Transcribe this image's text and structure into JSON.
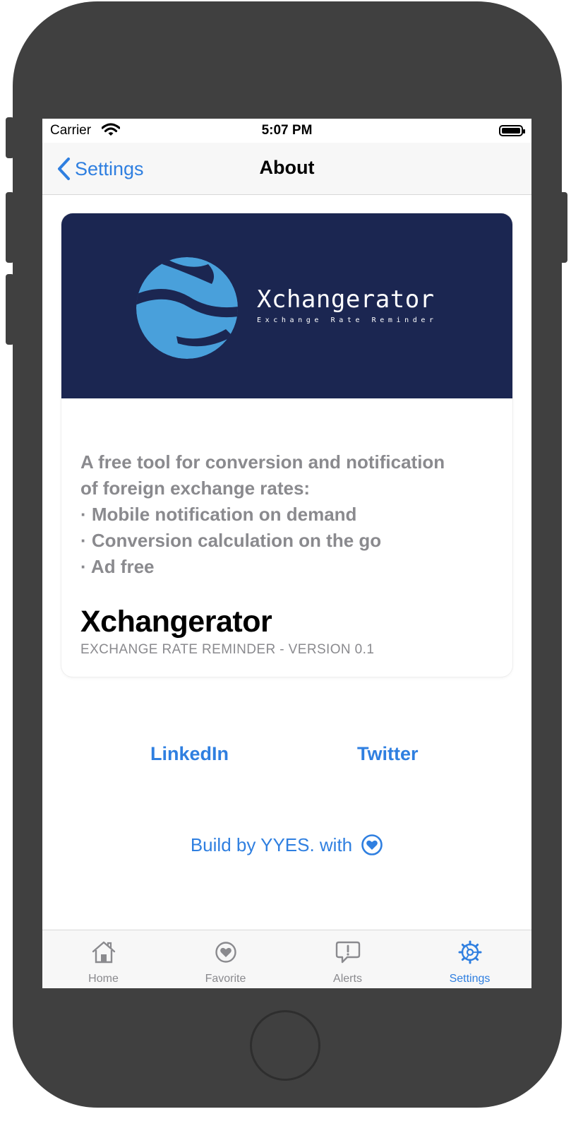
{
  "status_bar": {
    "carrier": "Carrier",
    "time": "5:07 PM"
  },
  "nav": {
    "back_label": "Settings",
    "title": "About"
  },
  "banner": {
    "title": "Xchangerator",
    "subtitle": "Exchange Rate Reminder"
  },
  "card": {
    "description": [
      "A free tool for conversion and notification",
      "of foreign exchange rates:",
      "· Mobile notification on demand",
      "· Conversion calculation on the go",
      "· Ad free"
    ],
    "app_name": "Xchangerator",
    "version_line": "EXCHANGE RATE REMINDER - VERSION 0.1"
  },
  "links": {
    "linkedin": "LinkedIn",
    "twitter": "Twitter"
  },
  "credit": {
    "text": "Build by YYES. with"
  },
  "tabs": [
    {
      "label": "Home",
      "icon": "house-icon"
    },
    {
      "label": "Favorite",
      "icon": "heart-circle-icon"
    },
    {
      "label": "Alerts",
      "icon": "exclamation-bubble-icon"
    },
    {
      "label": "Settings",
      "icon": "gear-icon"
    }
  ],
  "active_tab": "Settings",
  "colors": {
    "accent": "#2f7fe0",
    "banner_bg": "#1b2651",
    "globe": "#49a0db",
    "inactive": "#8a8a8e",
    "frame": "#404040"
  }
}
